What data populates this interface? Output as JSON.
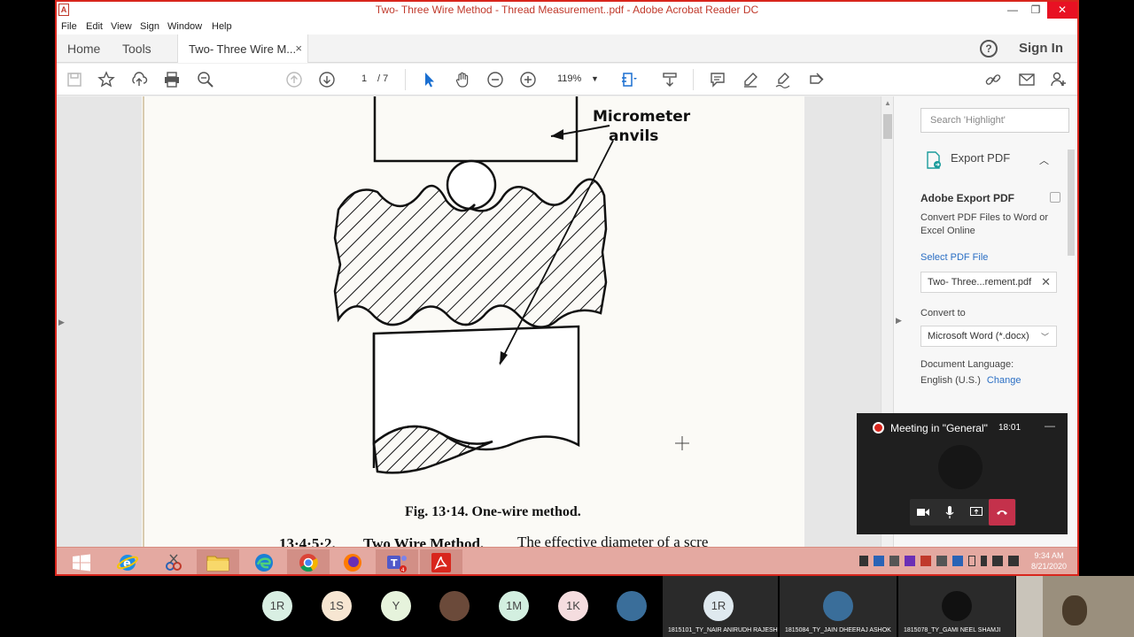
{
  "window": {
    "title": "Two- Three Wire Method - Thread Measurement..pdf - Adobe Acrobat Reader DC",
    "controls": {
      "minimize": "—",
      "restore": "❐",
      "close": "✕"
    }
  },
  "menu": [
    "File",
    "Edit",
    "View",
    "Sign",
    "Window",
    "Help"
  ],
  "tabs": {
    "home": "Home",
    "tools": "Tools",
    "document": "Two- Three Wire M...",
    "close": "×",
    "help": "?",
    "sign_in": "Sign In"
  },
  "toolbar": {
    "page_current": "1",
    "page_total": "/ 7",
    "zoom": "119%"
  },
  "document": {
    "label_line1": "Micrometer",
    "label_line2": "anvils",
    "caption": "Fig. 13·14.   One-wire method.",
    "cutoff_heading": "13·4·5·2.",
    "cutoff_title": "Two Wire Method.",
    "cutoff_text": "The effective diameter of a scre"
  },
  "right_panel": {
    "search_placeholder": "Search 'Highlight'",
    "export_label": "Export PDF",
    "heading": "Adobe Export PDF",
    "desc": "Convert PDF Files to Word or Excel Online",
    "select_file": "Select PDF File",
    "file_name": "Two- Three...rement.pdf",
    "convert_to": "Convert to",
    "format": "Microsoft Word (*.docx)",
    "doc_lang": "Document Language:",
    "lang_value": "English (U.S.)",
    "change": "Change"
  },
  "taskbar": {
    "time": "9:34 AM",
    "date": "8/21/2020"
  },
  "meeting": {
    "title": "Meeting in \"General\"",
    "elapsed": "18:01"
  },
  "participants": [
    {
      "initials": "1R",
      "bg": "#d9efe3"
    },
    {
      "initials": "1S",
      "bg": "#f7e6d2"
    },
    {
      "initials": "Y",
      "bg": "#e6f3dc"
    },
    {
      "initials": "",
      "bg": "#6b4a3a"
    },
    {
      "initials": "1M",
      "bg": "#d3efe0"
    },
    {
      "initials": "1K",
      "bg": "#f5dddf"
    },
    {
      "initials": "",
      "bg": "#3a6e9a"
    }
  ],
  "tiles": [
    {
      "initials": "1R",
      "name": "1815101_TY_NAIR ANIRUDH RAJESH"
    },
    {
      "initials": "",
      "name": "1815084_TY_JAIN DHEERAJ ASHOK"
    },
    {
      "initials": "",
      "name": "1815078_TY_GAMI NEEL SHAMJI"
    }
  ]
}
